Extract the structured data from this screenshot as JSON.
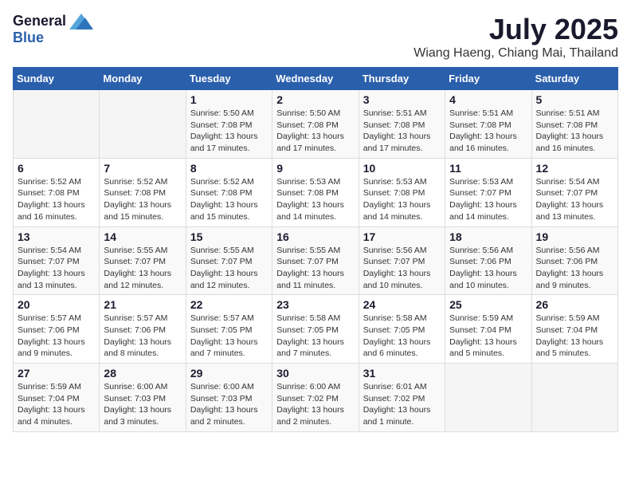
{
  "header": {
    "logo_general": "General",
    "logo_blue": "Blue",
    "month_title": "July 2025",
    "location": "Wiang Haeng, Chiang Mai, Thailand"
  },
  "days_of_week": [
    "Sunday",
    "Monday",
    "Tuesday",
    "Wednesday",
    "Thursday",
    "Friday",
    "Saturday"
  ],
  "weeks": [
    [
      {
        "day": "",
        "info": ""
      },
      {
        "day": "",
        "info": ""
      },
      {
        "day": "1",
        "info": "Sunrise: 5:50 AM\nSunset: 7:08 PM\nDaylight: 13 hours\nand 17 minutes."
      },
      {
        "day": "2",
        "info": "Sunrise: 5:50 AM\nSunset: 7:08 PM\nDaylight: 13 hours\nand 17 minutes."
      },
      {
        "day": "3",
        "info": "Sunrise: 5:51 AM\nSunset: 7:08 PM\nDaylight: 13 hours\nand 17 minutes."
      },
      {
        "day": "4",
        "info": "Sunrise: 5:51 AM\nSunset: 7:08 PM\nDaylight: 13 hours\nand 16 minutes."
      },
      {
        "day": "5",
        "info": "Sunrise: 5:51 AM\nSunset: 7:08 PM\nDaylight: 13 hours\nand 16 minutes."
      }
    ],
    [
      {
        "day": "6",
        "info": "Sunrise: 5:52 AM\nSunset: 7:08 PM\nDaylight: 13 hours\nand 16 minutes."
      },
      {
        "day": "7",
        "info": "Sunrise: 5:52 AM\nSunset: 7:08 PM\nDaylight: 13 hours\nand 15 minutes."
      },
      {
        "day": "8",
        "info": "Sunrise: 5:52 AM\nSunset: 7:08 PM\nDaylight: 13 hours\nand 15 minutes."
      },
      {
        "day": "9",
        "info": "Sunrise: 5:53 AM\nSunset: 7:08 PM\nDaylight: 13 hours\nand 14 minutes."
      },
      {
        "day": "10",
        "info": "Sunrise: 5:53 AM\nSunset: 7:08 PM\nDaylight: 13 hours\nand 14 minutes."
      },
      {
        "day": "11",
        "info": "Sunrise: 5:53 AM\nSunset: 7:07 PM\nDaylight: 13 hours\nand 14 minutes."
      },
      {
        "day": "12",
        "info": "Sunrise: 5:54 AM\nSunset: 7:07 PM\nDaylight: 13 hours\nand 13 minutes."
      }
    ],
    [
      {
        "day": "13",
        "info": "Sunrise: 5:54 AM\nSunset: 7:07 PM\nDaylight: 13 hours\nand 13 minutes."
      },
      {
        "day": "14",
        "info": "Sunrise: 5:55 AM\nSunset: 7:07 PM\nDaylight: 13 hours\nand 12 minutes."
      },
      {
        "day": "15",
        "info": "Sunrise: 5:55 AM\nSunset: 7:07 PM\nDaylight: 13 hours\nand 12 minutes."
      },
      {
        "day": "16",
        "info": "Sunrise: 5:55 AM\nSunset: 7:07 PM\nDaylight: 13 hours\nand 11 minutes."
      },
      {
        "day": "17",
        "info": "Sunrise: 5:56 AM\nSunset: 7:07 PM\nDaylight: 13 hours\nand 10 minutes."
      },
      {
        "day": "18",
        "info": "Sunrise: 5:56 AM\nSunset: 7:06 PM\nDaylight: 13 hours\nand 10 minutes."
      },
      {
        "day": "19",
        "info": "Sunrise: 5:56 AM\nSunset: 7:06 PM\nDaylight: 13 hours\nand 9 minutes."
      }
    ],
    [
      {
        "day": "20",
        "info": "Sunrise: 5:57 AM\nSunset: 7:06 PM\nDaylight: 13 hours\nand 9 minutes."
      },
      {
        "day": "21",
        "info": "Sunrise: 5:57 AM\nSunset: 7:06 PM\nDaylight: 13 hours\nand 8 minutes."
      },
      {
        "day": "22",
        "info": "Sunrise: 5:57 AM\nSunset: 7:05 PM\nDaylight: 13 hours\nand 7 minutes."
      },
      {
        "day": "23",
        "info": "Sunrise: 5:58 AM\nSunset: 7:05 PM\nDaylight: 13 hours\nand 7 minutes."
      },
      {
        "day": "24",
        "info": "Sunrise: 5:58 AM\nSunset: 7:05 PM\nDaylight: 13 hours\nand 6 minutes."
      },
      {
        "day": "25",
        "info": "Sunrise: 5:59 AM\nSunset: 7:04 PM\nDaylight: 13 hours\nand 5 minutes."
      },
      {
        "day": "26",
        "info": "Sunrise: 5:59 AM\nSunset: 7:04 PM\nDaylight: 13 hours\nand 5 minutes."
      }
    ],
    [
      {
        "day": "27",
        "info": "Sunrise: 5:59 AM\nSunset: 7:04 PM\nDaylight: 13 hours\nand 4 minutes."
      },
      {
        "day": "28",
        "info": "Sunrise: 6:00 AM\nSunset: 7:03 PM\nDaylight: 13 hours\nand 3 minutes."
      },
      {
        "day": "29",
        "info": "Sunrise: 6:00 AM\nSunset: 7:03 PM\nDaylight: 13 hours\nand 2 minutes."
      },
      {
        "day": "30",
        "info": "Sunrise: 6:00 AM\nSunset: 7:02 PM\nDaylight: 13 hours\nand 2 minutes."
      },
      {
        "day": "31",
        "info": "Sunrise: 6:01 AM\nSunset: 7:02 PM\nDaylight: 13 hours\nand 1 minute."
      },
      {
        "day": "",
        "info": ""
      },
      {
        "day": "",
        "info": ""
      }
    ]
  ]
}
